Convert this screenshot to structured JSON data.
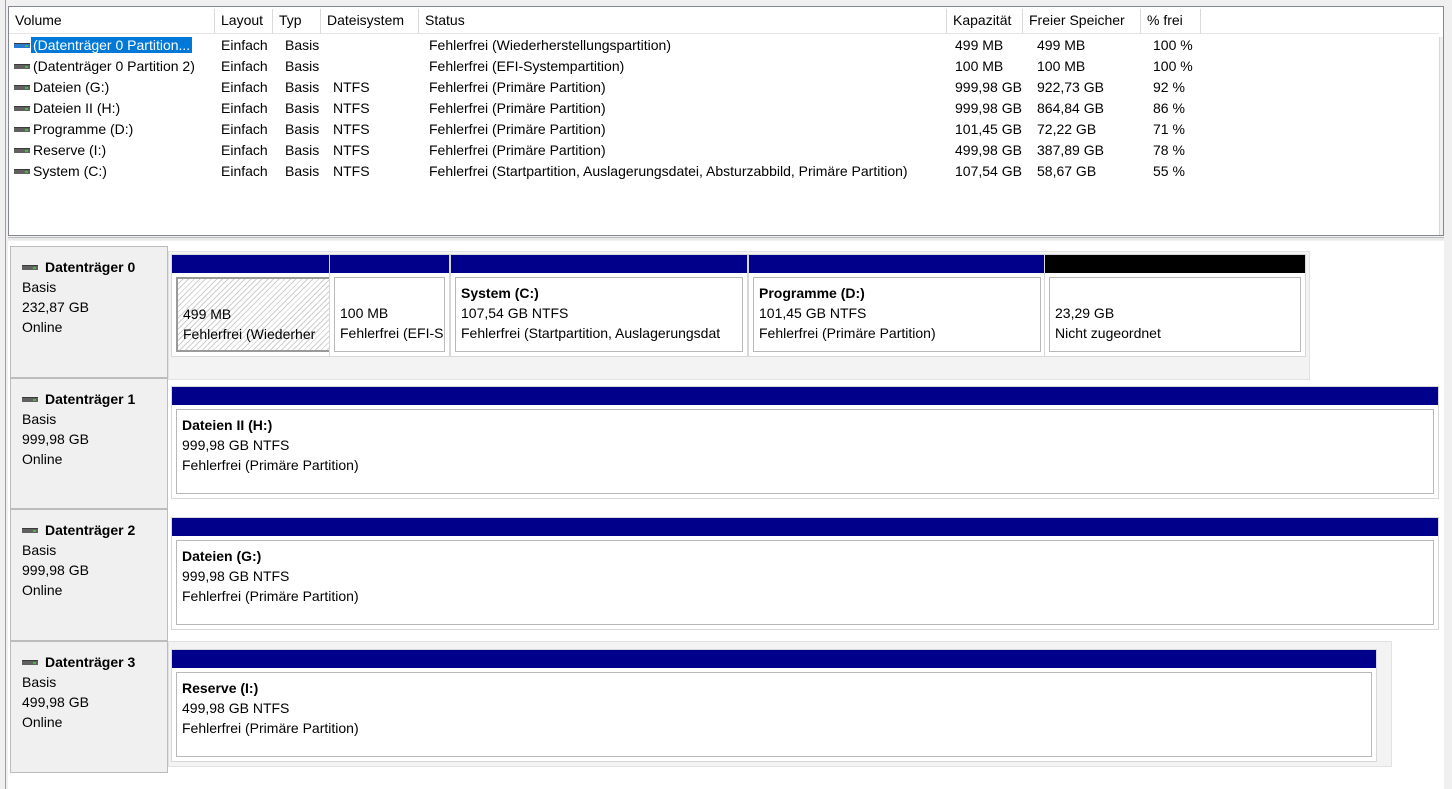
{
  "columns": [
    "Volume",
    "Layout",
    "Typ",
    "Dateisystem",
    "Status",
    "Kapazität",
    "Freier Speicher",
    "% frei"
  ],
  "volumes": [
    {
      "name": "(Datenträger 0 Partition...",
      "layout": "Einfach",
      "typ": "Basis",
      "fs": "",
      "status": "Fehlerfrei (Wiederherstellungspartition)",
      "kap": "499 MB",
      "frei": "499 MB",
      "pct": "100 %",
      "selected": true
    },
    {
      "name": "(Datenträger 0 Partition 2)",
      "layout": "Einfach",
      "typ": "Basis",
      "fs": "",
      "status": "Fehlerfrei (EFI-Systempartition)",
      "kap": "100 MB",
      "frei": "100 MB",
      "pct": "100 %"
    },
    {
      "name": "Dateien (G:)",
      "layout": "Einfach",
      "typ": "Basis",
      "fs": "NTFS",
      "status": "Fehlerfrei (Primäre Partition)",
      "kap": "999,98 GB",
      "frei": "922,73 GB",
      "pct": "92 %"
    },
    {
      "name": "Dateien II (H:)",
      "layout": "Einfach",
      "typ": "Basis",
      "fs": "NTFS",
      "status": "Fehlerfrei (Primäre Partition)",
      "kap": "999,98 GB",
      "frei": "864,84 GB",
      "pct": "86 %"
    },
    {
      "name": "Programme (D:)",
      "layout": "Einfach",
      "typ": "Basis",
      "fs": "NTFS",
      "status": "Fehlerfrei (Primäre Partition)",
      "kap": "101,45 GB",
      "frei": "72,22 GB",
      "pct": "71 %"
    },
    {
      "name": "Reserve (I:)",
      "layout": "Einfach",
      "typ": "Basis",
      "fs": "NTFS",
      "status": "Fehlerfrei (Primäre Partition)",
      "kap": "499,98 GB",
      "frei": "387,89 GB",
      "pct": "78 %"
    },
    {
      "name": "System (C:)",
      "layout": "Einfach",
      "typ": "Basis",
      "fs": "NTFS",
      "status": "Fehlerfrei (Startpartition, Auslagerungsdatei, Absturzabbild, Primäre Partition)",
      "kap": "107,54 GB",
      "frei": "58,67 GB",
      "pct": "55 %"
    }
  ],
  "disks": [
    {
      "name": "Datenträger 0",
      "type": "Basis",
      "size": "232,87 GB",
      "state": "Online",
      "parts": [
        {
          "title": "",
          "line1": "499 MB",
          "line2": "Fehlerfrei (Wiederher",
          "style": "recovery"
        },
        {
          "title": "",
          "line1": "100 MB",
          "line2": "Fehlerfrei (EFI-S",
          "style": "recovery"
        },
        {
          "title": "System  (C:)",
          "line1": "107,54 GB NTFS",
          "line2": "Fehlerfrei (Startpartition, Auslagerungsdat"
        },
        {
          "title": "Programme  (D:)",
          "line1": "101,45 GB NTFS",
          "line2": "Fehlerfrei (Primäre Partition)"
        },
        {
          "title": "",
          "line1": "23,29 GB",
          "line2": "Nicht zugeordnet",
          "style": "unallocated"
        }
      ]
    },
    {
      "name": "Datenträger 1",
      "type": "Basis",
      "size": "999,98 GB",
      "state": "Online",
      "parts": [
        {
          "title": "Dateien II  (H:)",
          "line1": "999,98 GB NTFS",
          "line2": "Fehlerfrei (Primäre Partition)"
        }
      ]
    },
    {
      "name": "Datenträger 2",
      "type": "Basis",
      "size": "999,98 GB",
      "state": "Online",
      "parts": [
        {
          "title": "Dateien  (G:)",
          "line1": "999,98 GB NTFS",
          "line2": "Fehlerfrei (Primäre Partition)"
        }
      ]
    },
    {
      "name": "Datenträger 3",
      "type": "Basis",
      "size": "499,98 GB",
      "state": "Online",
      "parts": [
        {
          "title": "Reserve  (I:)",
          "line1": "499,98 GB NTFS",
          "line2": "Fehlerfrei (Primäre Partition)"
        }
      ]
    }
  ],
  "colors": {
    "partition_bar": "#00008b",
    "unallocated_bar": "#000000",
    "selection": "#0078d7"
  }
}
